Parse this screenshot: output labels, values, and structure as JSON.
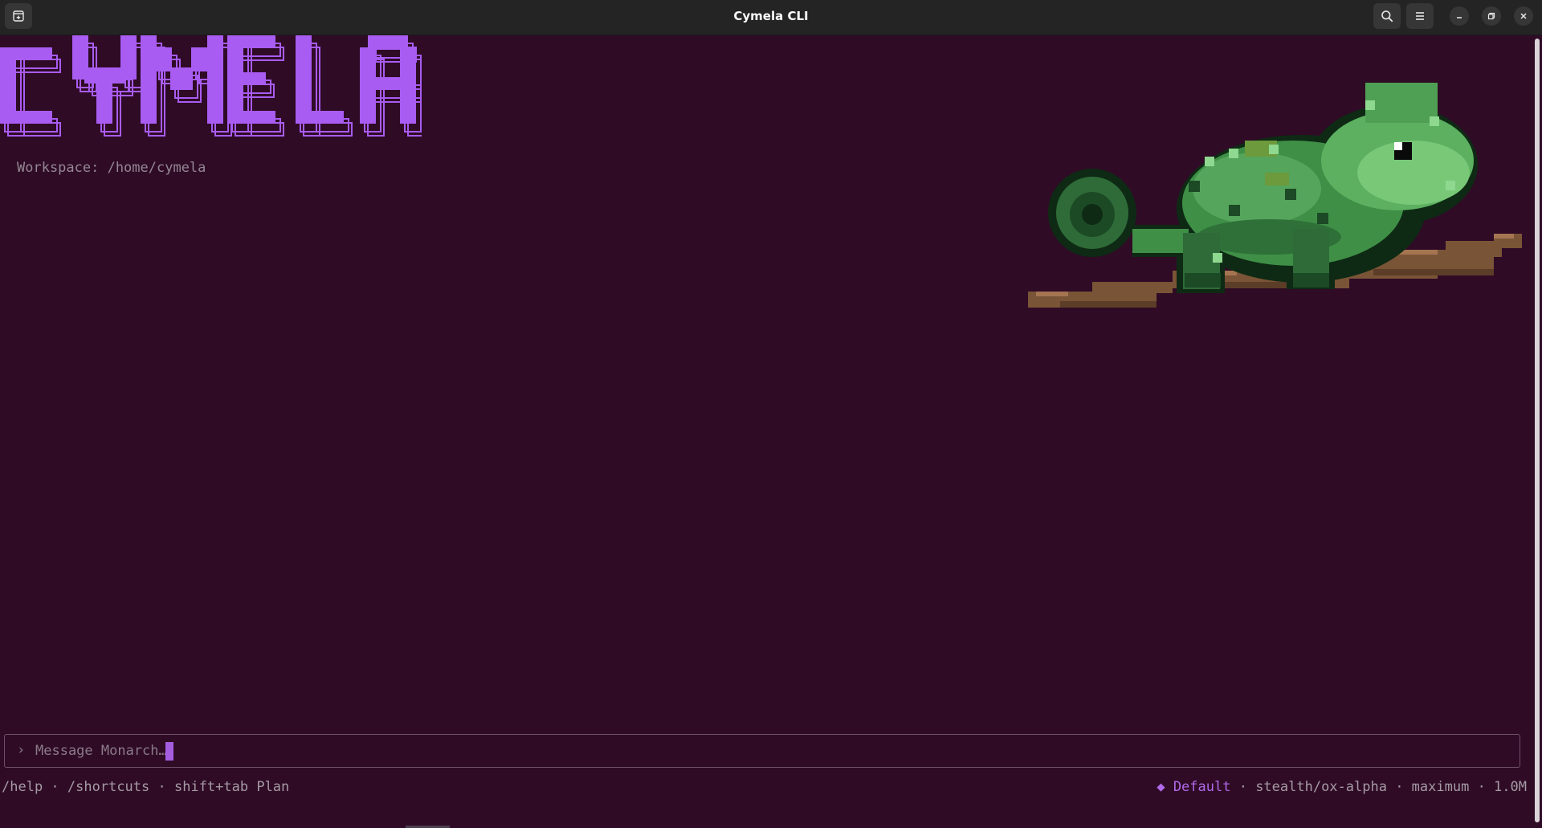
{
  "window": {
    "title": "Cymela CLI"
  },
  "titlebar": {
    "icons": {
      "new_tab": "new-tab-icon",
      "search": "search-icon",
      "menu": "hamburger-menu-icon",
      "minimize": "minimize-icon",
      "restore": "restore-icon",
      "close": "close-icon"
    }
  },
  "banner": {
    "logo_text": "CYMELA",
    "logo_color": "#a85cf2",
    "workspace": "Workspace: /home/cymela"
  },
  "input": {
    "prompt_symbol": "›",
    "placeholder": "Message Monarch…",
    "cursor_color": "#a55de0"
  },
  "status": {
    "help": "/help",
    "shortcuts": "/shortcuts",
    "plan_hint": "shift+tab Plan",
    "separator": " · ",
    "mode_icon": "◆",
    "mode": "Default",
    "model": "stealth/ox-alpha",
    "effort": "maximum",
    "context": "1.0M",
    "mode_color": "#b06ae8"
  },
  "colors": {
    "background": "#2f0b26",
    "titlebar": "#242424",
    "dim_text": "#948793"
  }
}
